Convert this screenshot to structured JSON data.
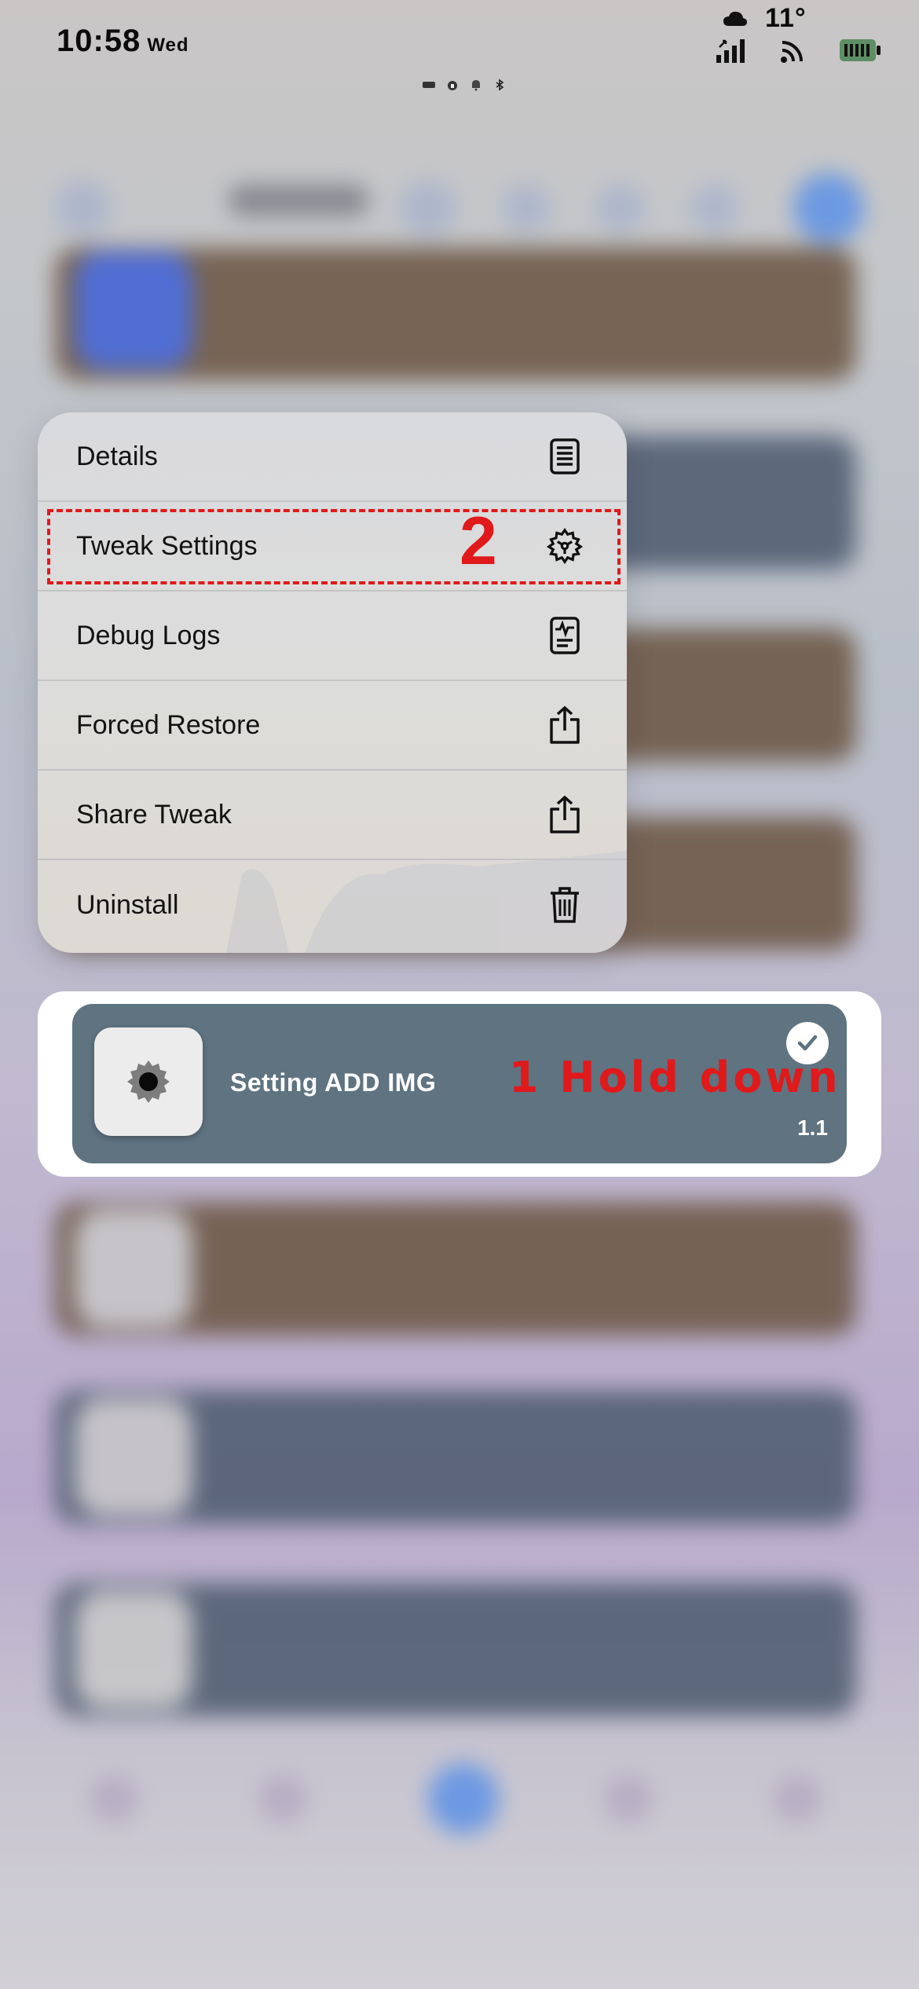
{
  "status_bar": {
    "time": "10:58",
    "day": "Wed",
    "temperature": "11°",
    "icons": [
      "cloud-icon",
      "signal-icon",
      "wifi-icon",
      "battery-icon",
      "vpn-icon",
      "lock-icon",
      "bell-icon",
      "bluetooth-icon"
    ],
    "battery_color": "#5e8f64"
  },
  "context_menu": {
    "items": [
      {
        "label": "Details",
        "icon": "document-icon"
      },
      {
        "label": "Tweak Settings",
        "icon": "gear-icon"
      },
      {
        "label": "Debug Logs",
        "icon": "log-file-icon"
      },
      {
        "label": "Forced Restore",
        "icon": "share-icon"
      },
      {
        "label": "Share Tweak",
        "icon": "share-icon"
      },
      {
        "label": "Uninstall",
        "icon": "trash-icon"
      }
    ]
  },
  "tweak_card": {
    "title": "Setting ADD IMG",
    "version": "1.1",
    "enabled": true,
    "card_color": "#5f7381"
  },
  "annotations": {
    "step_1": "1 Hold down",
    "step_2": "2",
    "color": "#e0191b"
  }
}
